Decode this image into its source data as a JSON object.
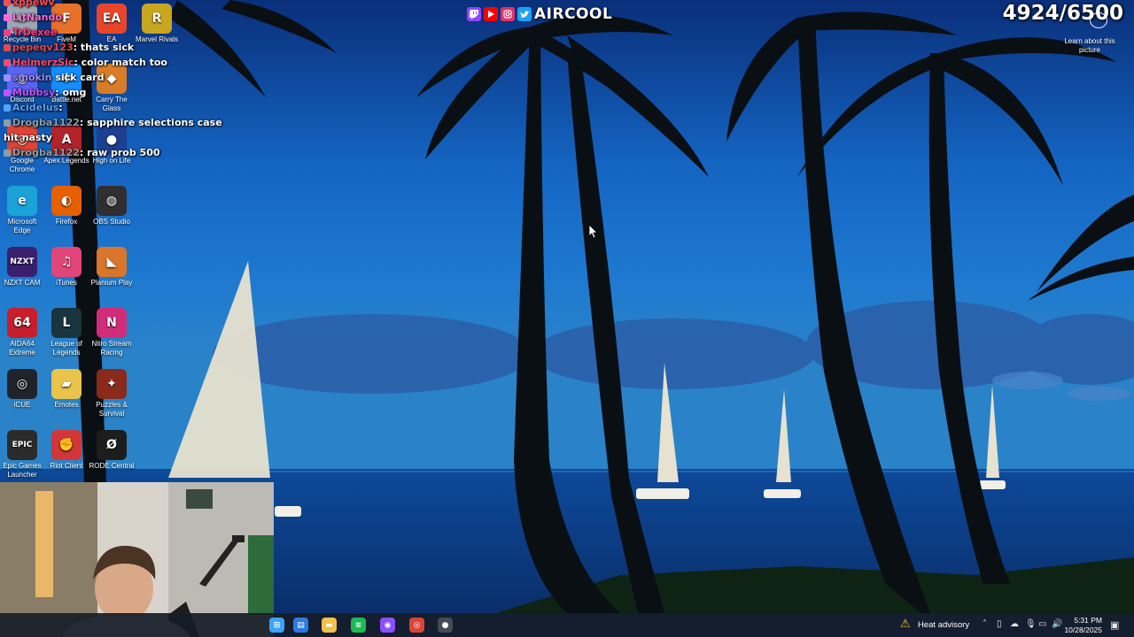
{
  "overlay": {
    "brand": "AIRCOOL",
    "counter": "4924/6500",
    "learn_about": "Learn about this picture"
  },
  "desktop_icons": [
    {
      "label": "Recycle Bin",
      "icon": "recycle-bin-icon",
      "color": "#9aa7b5",
      "glyph": "♻"
    },
    {
      "label": "FiveM",
      "icon": "fivem-icon",
      "color": "#e8702a",
      "glyph": "F"
    },
    {
      "label": "EA",
      "icon": "ea-icon",
      "color": "#e8462a",
      "glyph": "EA"
    },
    {
      "label": "Marvel Rivals",
      "icon": "marvel-rivals-icon",
      "color": "#c9a620",
      "glyph": "R"
    },
    {
      "label": "Discord",
      "icon": "discord-icon",
      "color": "#5865f2",
      "glyph": "◉"
    },
    {
      "label": "Battle.net",
      "icon": "battlenet-icon",
      "color": "#148eff",
      "glyph": "✱"
    },
    {
      "label": "Carry The Glass",
      "icon": "carry-the-glass-icon",
      "color": "#d97c28",
      "glyph": "◆"
    },
    {
      "label": "Google Chrome",
      "icon": "chrome-icon",
      "color": "#db4437",
      "glyph": "◎"
    },
    {
      "label": "Apex Legends",
      "icon": "apex-legends-icon",
      "color": "#b3242a",
      "glyph": "A"
    },
    {
      "label": "High on Life",
      "icon": "high-on-life-icon",
      "color": "#1d3f8f",
      "glyph": "●"
    },
    {
      "label": "Microsoft Edge",
      "icon": "edge-icon",
      "color": "#1ba2d6",
      "glyph": "e"
    },
    {
      "label": "Firefox",
      "icon": "firefox-icon",
      "color": "#e66000",
      "glyph": "◐"
    },
    {
      "label": "OBS Studio",
      "icon": "obs-studio-icon",
      "color": "#302e31",
      "glyph": "◍"
    },
    {
      "label": "NZXT CAM",
      "icon": "nzxt-cam-icon",
      "color": "#3a1f6e",
      "glyph": "NZXT"
    },
    {
      "label": "iTunes",
      "icon": "itunes-icon",
      "color": "#e2457a",
      "glyph": "♫"
    },
    {
      "label": "Planium Play",
      "icon": "planium-play-icon",
      "color": "#d9762b",
      "glyph": "◣"
    },
    {
      "label": "AIDA64 Extreme",
      "icon": "aida64-icon",
      "color": "#c81e2b",
      "glyph": "64"
    },
    {
      "label": "League of Legends",
      "icon": "league-of-legends-icon",
      "color": "#18353d",
      "glyph": "L"
    },
    {
      "label": "Nitro Stream Racing",
      "icon": "nitro-stream-racing-icon",
      "color": "#d12c7a",
      "glyph": "N"
    },
    {
      "label": "iCUE",
      "icon": "icue-icon",
      "color": "#20242a",
      "glyph": "◎"
    },
    {
      "label": "Emotes",
      "icon": "folder-icon",
      "color": "#e9c34a",
      "glyph": "▰"
    },
    {
      "label": "Puzzles & Survival",
      "icon": "puzzles-survival-icon",
      "color": "#8a2a1a",
      "glyph": "✦"
    },
    {
      "label": "Epic Games Launcher",
      "icon": "epic-games-icon",
      "color": "#2b2b2b",
      "glyph": "EPIC"
    },
    {
      "label": "Riot Client",
      "icon": "riot-client-icon",
      "color": "#d13639",
      "glyph": "✊"
    },
    {
      "label": "RODE Central",
      "icon": "rode-central-icon",
      "color": "#1d1d1d",
      "glyph": "Ø"
    }
  ],
  "chat": [
    {
      "user": "xppewv",
      "message": "",
      "color": "#ff4d4d"
    },
    {
      "user": "LitNando",
      "message": "",
      "color": "#ff6bd6"
    },
    {
      "user": "pepeqv123",
      "message": ": thats sick",
      "color": "#e24a4a"
    },
    {
      "user": "TrDexee",
      "message": "",
      "color": "#ff3d7f"
    },
    {
      "user": "HelmerzSic",
      "message": ": color match too",
      "color": "#ff4a6a"
    },
    {
      "user": "smokin",
      "message": " sick card",
      "color": "#9e8cff"
    },
    {
      "user": "Mubbsy",
      "message": ": omg",
      "color": "#c052ff"
    },
    {
      "user": "Acidelus",
      "message": ": ",
      "color": "#53a4ff"
    },
    {
      "user": "Drogba1122",
      "message": ": sapphire selections case",
      "color": "#8aa0a8"
    },
    {
      "user": "",
      "message": "hit nasty",
      "color": "#ffffff"
    },
    {
      "user": "Drogba1122",
      "message": ": raw prob 500",
      "color": "#8aa0a8"
    }
  ],
  "taskbar": {
    "apps": [
      {
        "name": "start",
        "icon": "windows-start-icon",
        "color": "#3aa3ff"
      },
      {
        "name": "store",
        "icon": "microsoft-store-icon",
        "color": "#2d7ae0"
      },
      {
        "name": "explorer",
        "icon": "file-explorer-icon",
        "color": "#f0c24a"
      },
      {
        "name": "spotify",
        "icon": "spotify-icon",
        "color": "#1db954"
      },
      {
        "name": "obs",
        "icon": "obs-taskbar-icon",
        "color": "#8a4fff"
      },
      {
        "name": "chrome",
        "icon": "chrome-taskbar-icon",
        "color": "#db4437"
      },
      {
        "name": "recorder",
        "icon": "recorder-icon",
        "color": "#444a55"
      }
    ],
    "weather": "Heat advisory",
    "time": "5:31 PM",
    "date": "10/28/2025"
  }
}
